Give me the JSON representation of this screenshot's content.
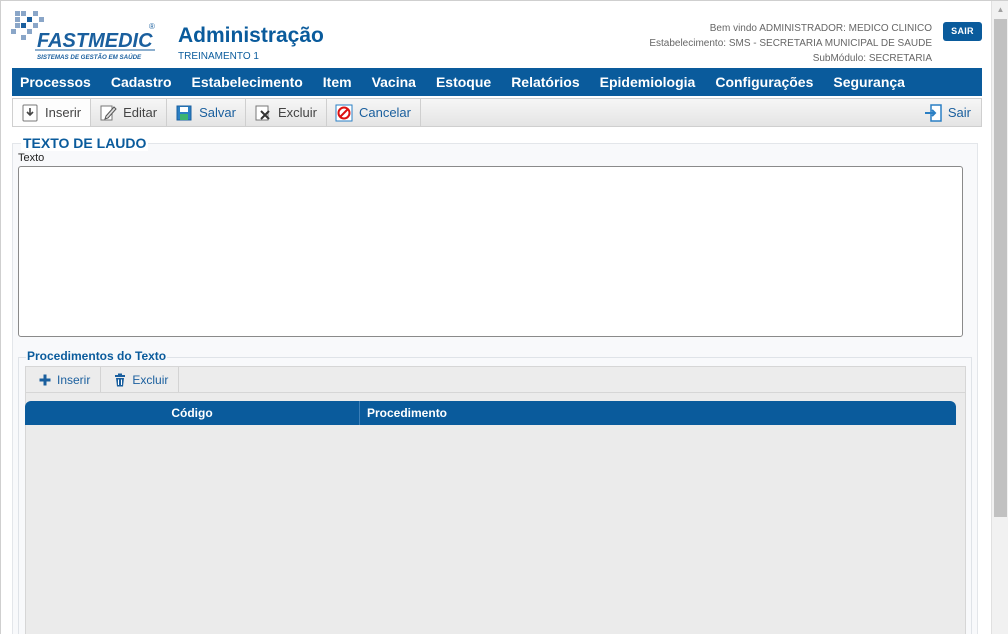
{
  "brand": {
    "logo_text": "FASTMEDIC",
    "logo_tagline": "SISTEMAS DE GESTÃO EM SAÚDE",
    "registered": "®"
  },
  "header": {
    "title": "Administração",
    "subtitle": "TREINAMENTO 1",
    "welcome": "Bem vindo ADMINISTRADOR: MEDICO CLINICO",
    "establishment": "Estabelecimento: SMS - SECRETARIA MUNICIPAL DE SAUDE",
    "submodule": "SubMódulo: SECRETARIA",
    "logout_label": "SAIR"
  },
  "menu": [
    "Processos",
    "Cadastro",
    "Estabelecimento",
    "Item",
    "Vacina",
    "Estoque",
    "Relatórios",
    "Epidemiologia",
    "Configurações",
    "Segurança"
  ],
  "toolbar": {
    "insert": "Inserir",
    "edit": "Editar",
    "save": "Salvar",
    "delete": "Excluir",
    "cancel": "Cancelar",
    "exit": "Sair"
  },
  "form": {
    "section_title": "TEXTO DE LAUDO",
    "text_label": "Texto",
    "text_value": ""
  },
  "procedures": {
    "section_title": "Procedimentos do Texto",
    "insert": "Inserir",
    "delete": "Excluir",
    "columns": [
      "Código",
      "Procedimento"
    ],
    "rows": []
  },
  "colors": {
    "brand_blue": "#0a5b9c",
    "toolbar_bg": "#e4e4e4"
  }
}
